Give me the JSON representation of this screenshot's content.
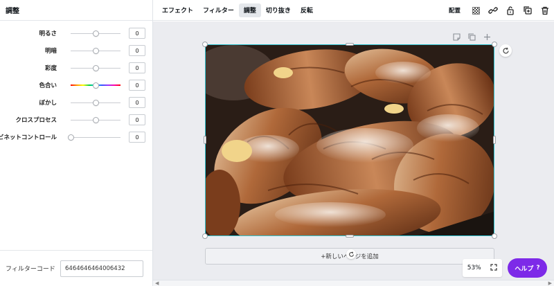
{
  "panel": {
    "title": "調整",
    "sliders": [
      {
        "label": "明るさ",
        "value": "0",
        "position": 0.5,
        "hue": false
      },
      {
        "label": "明暗",
        "value": "0",
        "position": 0.5,
        "hue": false
      },
      {
        "label": "彩度",
        "value": "0",
        "position": 0.5,
        "hue": false
      },
      {
        "label": "色合い",
        "value": "0",
        "position": 0.5,
        "hue": true
      },
      {
        "label": "ぼかし",
        "value": "0",
        "position": 0.5,
        "hue": false
      },
      {
        "label": "クロスプロセス",
        "value": "0",
        "position": 0.5,
        "hue": false
      },
      {
        "label": "ビネットコントロール",
        "value": "0",
        "position": 0.0,
        "hue": false
      }
    ],
    "filter_code_label": "フィルターコード",
    "filter_code_value": "6464646464006432"
  },
  "toolbar": {
    "tabs": [
      {
        "label": "エフェクト",
        "active": false
      },
      {
        "label": "フィルター",
        "active": false
      },
      {
        "label": "調整",
        "active": true
      },
      {
        "label": "切り抜き",
        "active": false
      },
      {
        "label": "反転",
        "active": false
      }
    ],
    "arrange_label": "配置",
    "icons": [
      "transparency-icon",
      "link-icon",
      "lock-icon",
      "duplicate-icon",
      "trash-icon"
    ]
  },
  "canvas": {
    "add_page_label": "+新しいページを追加",
    "zoom_label": "53%",
    "help_label": "ヘルプ",
    "help_mark": "?"
  },
  "colors": {
    "accent": "#7d2ae8",
    "selection": "#2ec3d0"
  }
}
